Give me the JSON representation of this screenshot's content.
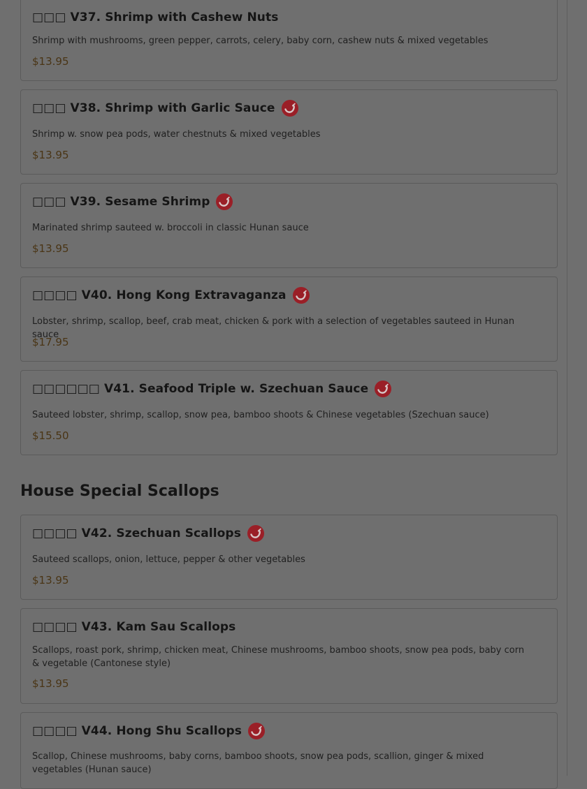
{
  "items": [
    {
      "title": "□□□ V37. Shrimp with Cashew Nuts",
      "description": "Shrimp with mushrooms, green pepper, carrots, celery, baby corn, cashew nuts & mixed vegetables",
      "price": "$13.95",
      "spicy": false,
      "icon": "chili-icon"
    },
    {
      "title": "□□□ V38. Shrimp with Garlic Sauce",
      "description": "Shrimp w. snow pea pods, water chestnuts & mixed vegetables",
      "price": "$13.95",
      "spicy": true,
      "icon": "chili-icon"
    },
    {
      "title": "□□□ V39. Sesame Shrimp",
      "description": "Marinated shrimp sauteed w. broccoli in classic Hunan sauce",
      "price": "$13.95",
      "spicy": true,
      "icon": "chili-icon"
    },
    {
      "title": "□□□□ V40. Hong Kong Extravaganza",
      "description": "Lobster, shrimp, scallop, beef, crab meat, chicken & pork with a selection of vegetables sauteed in Hunan sauce",
      "price": "$17.95",
      "spicy": true,
      "icon": "chili-icon"
    },
    {
      "title": "□□□□□□ V41. Seafood Triple w. Szechuan Sauce",
      "description": "Sauteed lobster, shrimp, scallop, snow pea, bamboo shoots & Chinese vegetables (Szechuan sauce)",
      "price": "$15.50",
      "spicy": true,
      "icon": "chili-icon"
    },
    {
      "title": "□□□□ V42. Szechuan Scallops",
      "description": "Sauteed scallops, onion, lettuce, pepper & other vegetables",
      "price": "$13.95",
      "spicy": true,
      "icon": "chili-icon"
    },
    {
      "title": "□□□□ V43. Kam Sau Scallops",
      "description": "Scallops, roast pork, shrimp, chicken meat, Chinese mushrooms, bamboo shoots, snow pea pods, baby corn & vegetable (Cantonese style)",
      "price": "$13.95",
      "spicy": false,
      "icon": "chili-icon"
    },
    {
      "title": "□□□□ V44. Hong Shu Scallops",
      "description": "Scallop, Chinese mushrooms, baby corns, bamboo shoots, snow pea pods, scallion, ginger & mixed vegetables (Hunan sauce)",
      "price": "",
      "spicy": true,
      "icon": "chili-icon"
    }
  ],
  "section": {
    "title": "House Special Scallops"
  },
  "colors": {
    "overlay_background": "#6f6f6f",
    "chili_red": "#9a1f27",
    "price_text": "#4a3515"
  }
}
